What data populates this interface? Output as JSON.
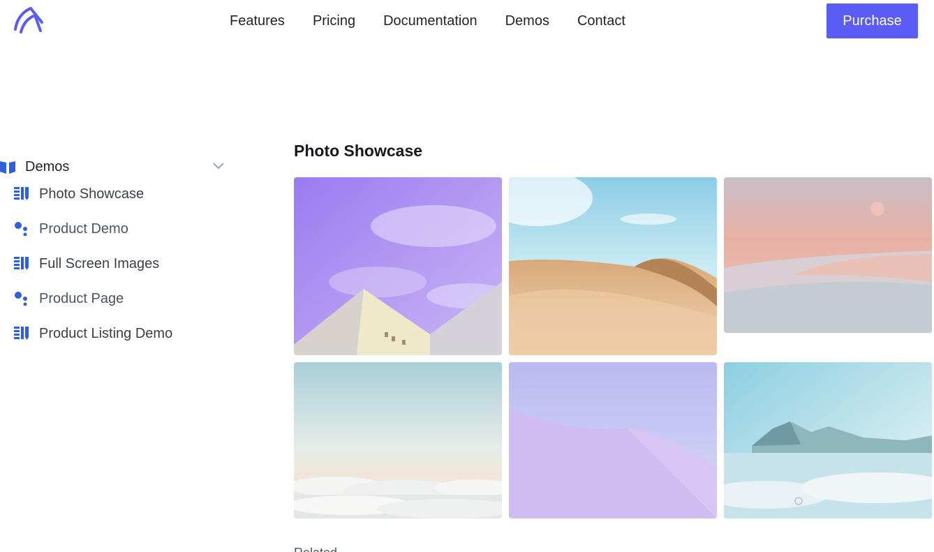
{
  "header": {
    "logo_icon": "brand-logo-icon",
    "nav": [
      "Features",
      "Pricing",
      "Documentation",
      "Demos",
      "Contact"
    ],
    "purchase_label": "Purchase",
    "accent": "#5b5cf6"
  },
  "sidebar": {
    "section_label": "Demos",
    "section_icon": "book-open-icon",
    "expand_icon": "chevron-down-icon",
    "items": [
      {
        "label": "Photo Showcase",
        "icon": "columns-icon"
      },
      {
        "label": "Product Demo",
        "icon": "dots-icon"
      },
      {
        "label": "Full Screen Images",
        "icon": "columns-icon"
      },
      {
        "label": "Product Page",
        "icon": "dots-icon"
      },
      {
        "label": "Product Listing Demo",
        "icon": "columns-icon"
      }
    ]
  },
  "main": {
    "title": "Photo Showcase",
    "photos": [
      "purple-sky-building",
      "desert-dunes",
      "pink-dunes",
      "clouds-horizon",
      "lavender-dune",
      "misty-mountains"
    ],
    "footer_text": "Related"
  }
}
